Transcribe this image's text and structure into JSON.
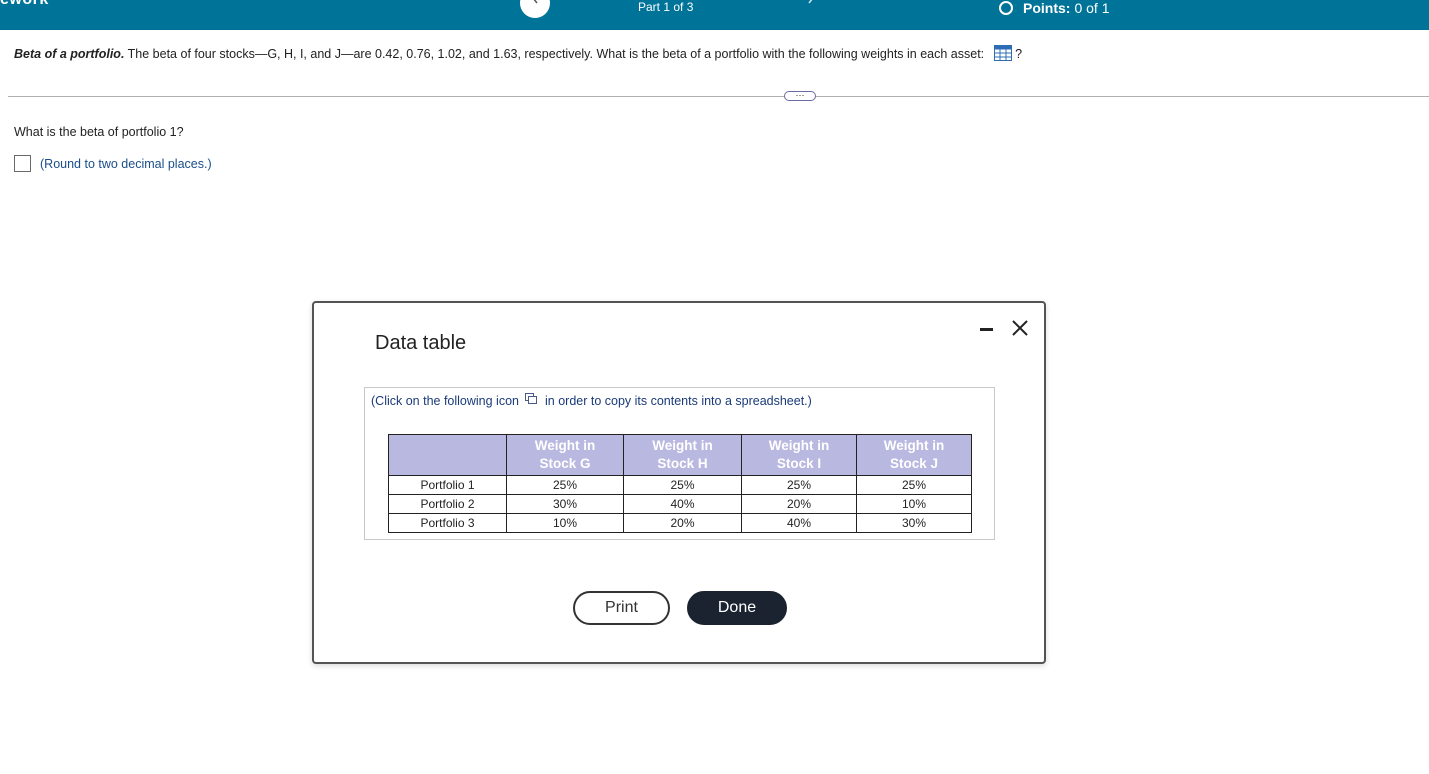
{
  "header": {
    "brand": "ework",
    "part": "Part 1 of 3",
    "points_label": "Points:",
    "points_value": "0 of 1"
  },
  "question": {
    "title": "Beta of a portfolio.",
    "text": "The beta of four stocks—G, H, I, and J—are 0.42, 0.76, 1.02, and 1.63, respectively.  What is the beta of a portfolio with the following weights in each asset:",
    "end": "?",
    "more_label": "⋯"
  },
  "subquestion": {
    "prompt": "What is the beta of portfolio 1?",
    "answer_value": "",
    "hint": "(Round to two decimal places.)"
  },
  "modal": {
    "title": "Data table",
    "copy_note_before": "(Click on the following icon",
    "copy_note_after": "in order to copy its contents into a spreadsheet.)",
    "columns": [
      {
        "line1": "Weight in",
        "line2": "Stock G"
      },
      {
        "line1": "Weight in",
        "line2": "Stock H"
      },
      {
        "line1": "Weight in",
        "line2": "Stock I"
      },
      {
        "line1": "Weight in",
        "line2": "Stock J"
      }
    ],
    "rows": [
      {
        "label": "Portfolio 1",
        "values": [
          "25%",
          "25%",
          "25%",
          "25%"
        ]
      },
      {
        "label": "Portfolio 2",
        "values": [
          "30%",
          "40%",
          "20%",
          "10%"
        ]
      },
      {
        "label": "Portfolio 3",
        "values": [
          "10%",
          "20%",
          "40%",
          "30%"
        ]
      }
    ],
    "print_label": "Print",
    "done_label": "Done"
  },
  "colors": {
    "header_bg": "#007398",
    "table_header_bg": "#b8b8e0",
    "done_bg": "#1b2331",
    "hint_text": "#1a4e8a"
  }
}
